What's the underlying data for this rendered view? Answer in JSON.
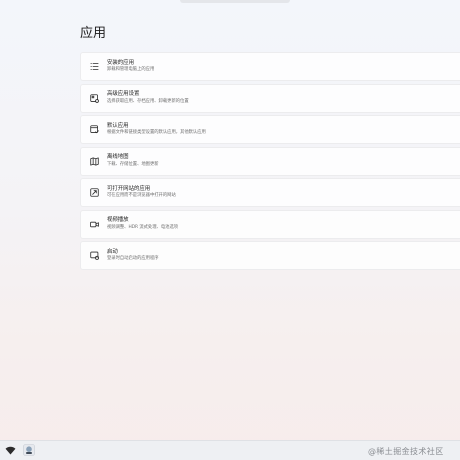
{
  "page": {
    "title": "应用"
  },
  "items": [
    {
      "icon": "app-list-icon",
      "title": "安装的应用",
      "desc": "卸载和管理电脑上的应用"
    },
    {
      "icon": "app-settings-icon",
      "title": "高级应用设置",
      "desc": "选择获取应用、存档应用、卸载更新的位置"
    },
    {
      "icon": "default-apps-icon",
      "title": "默认应用",
      "desc": "根据文件和链接类型设置的默认应用，其他默认应用"
    },
    {
      "icon": "offline-map-icon",
      "title": "离线地图",
      "desc": "下载、存储位置、地图更新"
    },
    {
      "icon": "web-app-icon",
      "title": "可打开网站的应用",
      "desc": "可在应用而不是浏览器中打开的网站"
    },
    {
      "icon": "video-icon",
      "title": "视频播放",
      "desc": "视频调整、HDR 流式处理、电池选项"
    },
    {
      "icon": "startup-icon",
      "title": "启动",
      "desc": "登录时自动启动的应用程序"
    }
  ],
  "watermark": "@稀土掘金技术社区"
}
